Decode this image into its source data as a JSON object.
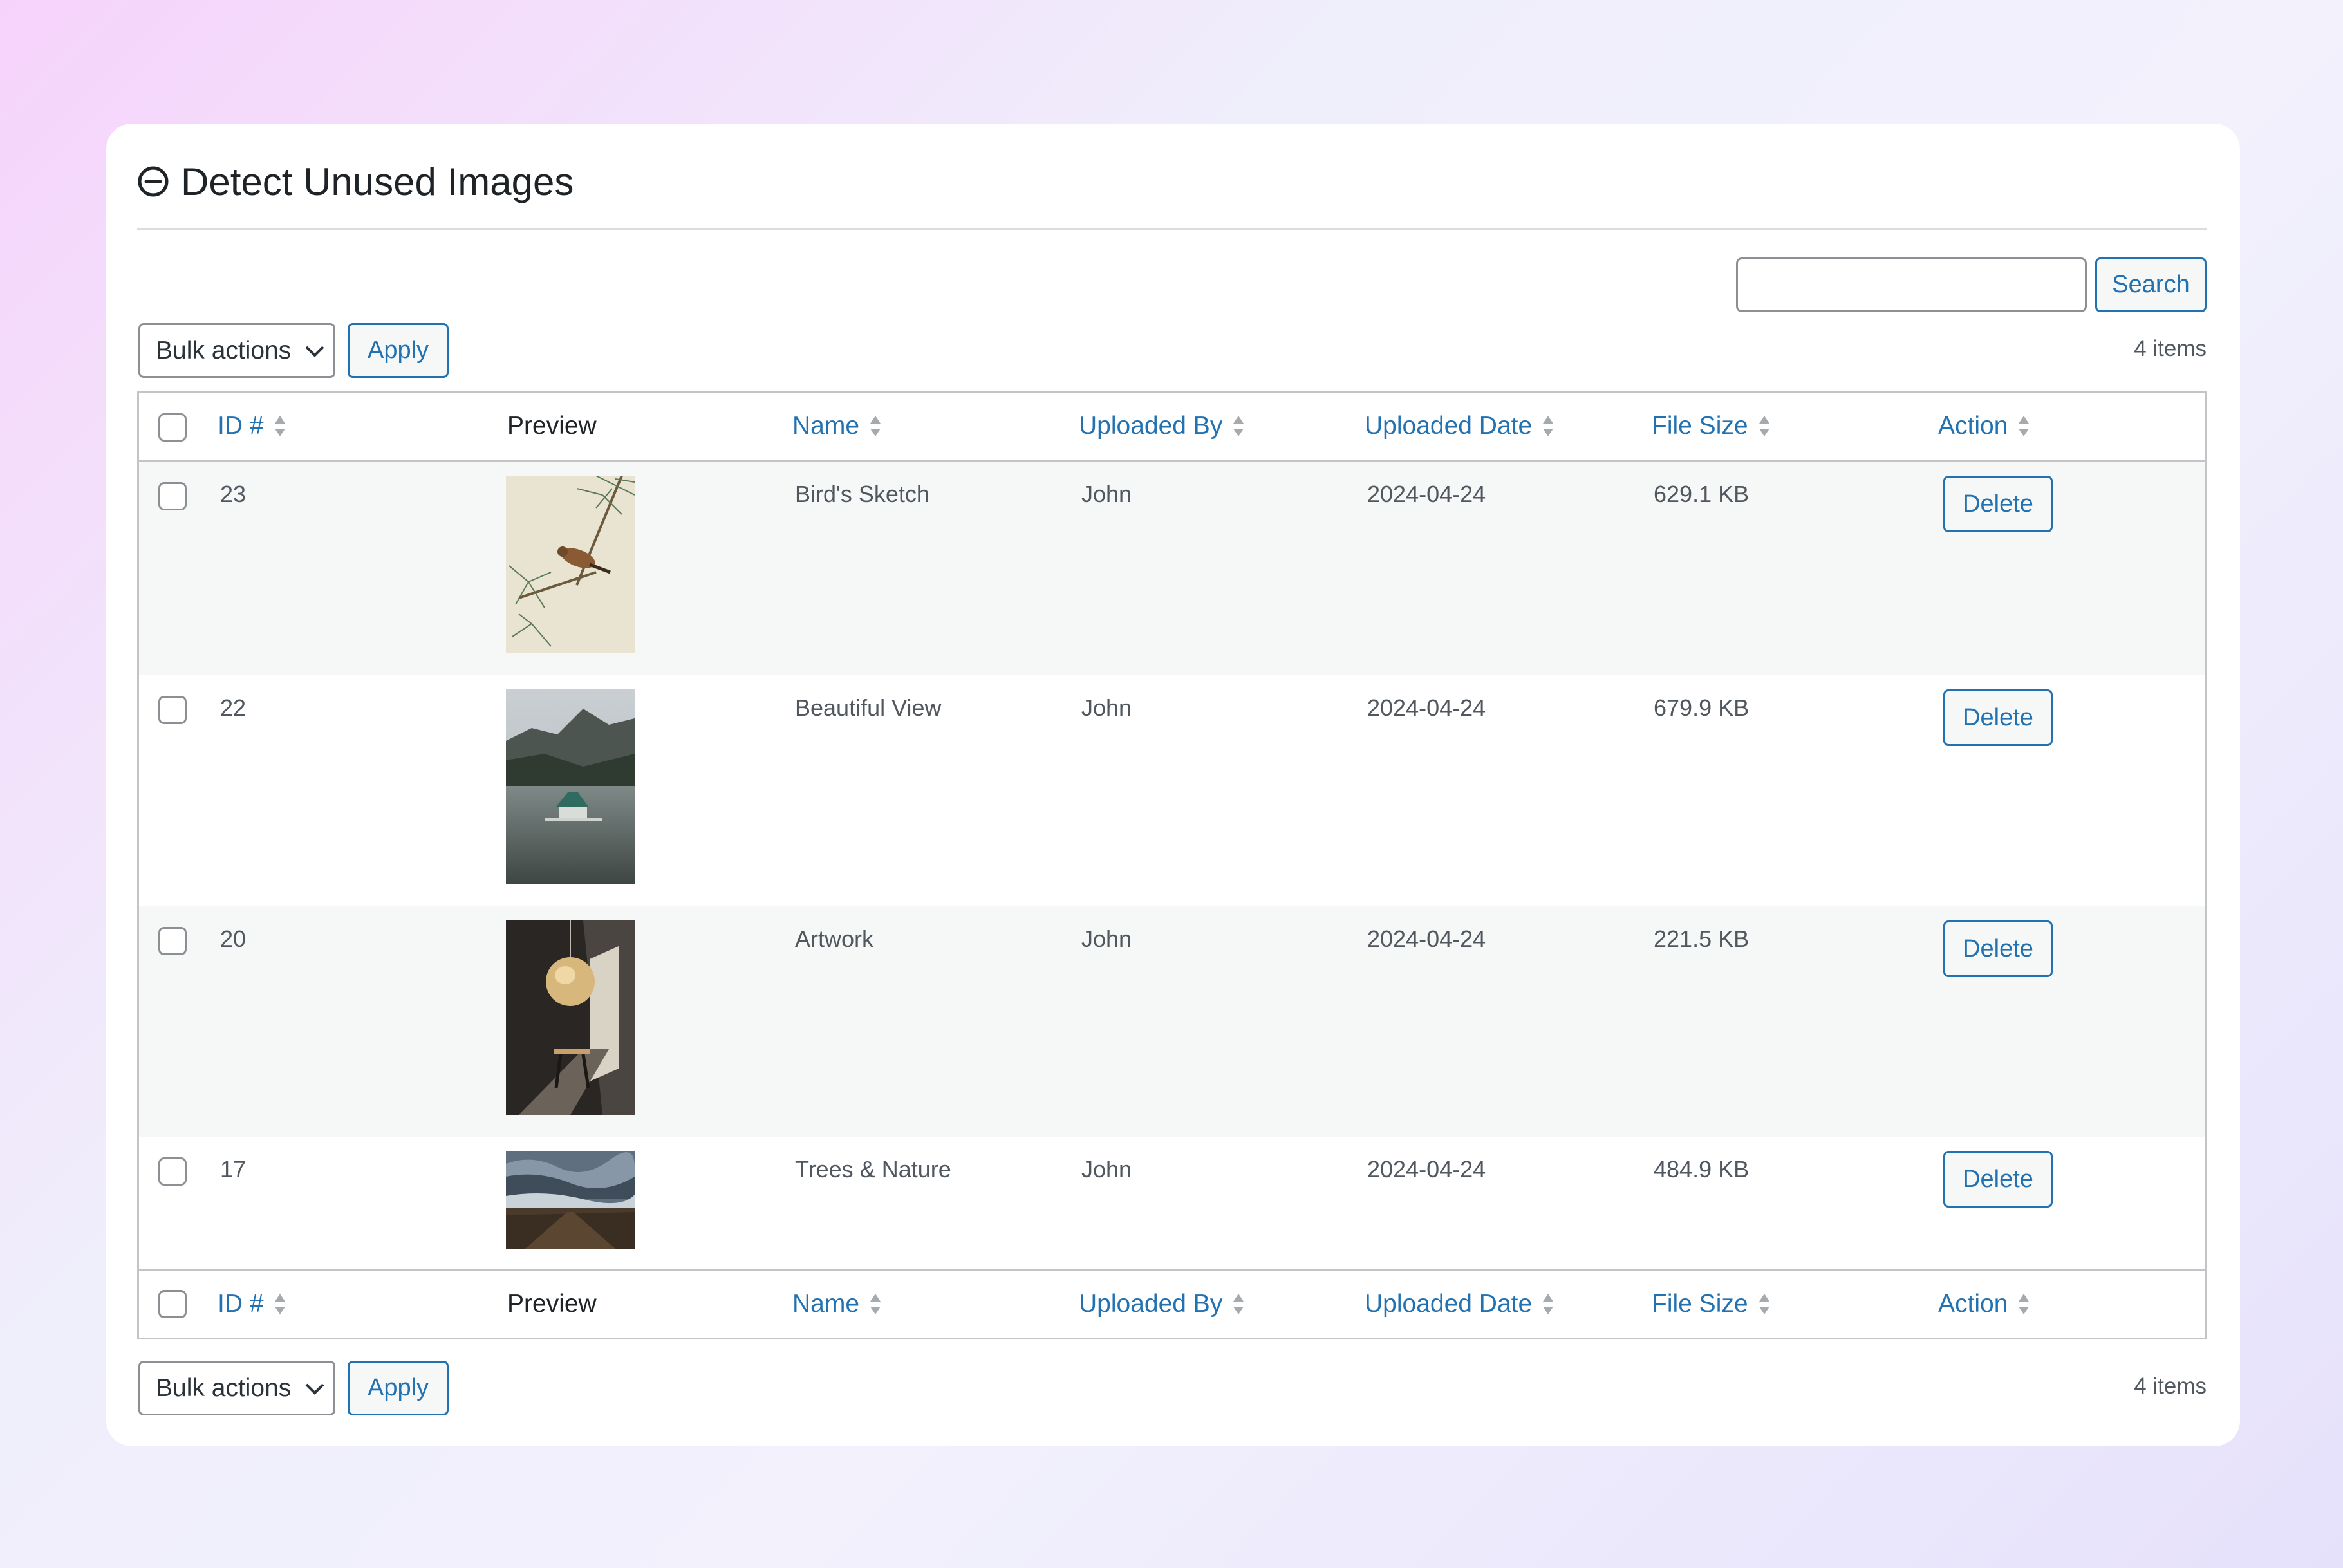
{
  "page": {
    "title": "Detect Unused Images",
    "title_icon": "minus-circle-icon",
    "accent_color": "#2271b1"
  },
  "search": {
    "value": "",
    "placeholder": "",
    "button_label": "Search"
  },
  "toolbar_top": {
    "bulk_label": "Bulk actions",
    "apply_label": "Apply",
    "items_count": "4 items"
  },
  "toolbar_bottom": {
    "bulk_label": "Bulk actions",
    "apply_label": "Apply",
    "items_count": "4 items"
  },
  "columns": {
    "id": "ID #",
    "preview": "Preview",
    "name": "Name",
    "uploaded_by": "Uploaded By",
    "uploaded_date": "Uploaded Date",
    "file_size": "File Size",
    "action": "Action"
  },
  "rows": [
    {
      "id": "23",
      "name": "Bird's Sketch",
      "uploaded_by": "John",
      "uploaded_date": "2024-04-24",
      "file_size": "629.1 KB",
      "action_label": "Delete",
      "preview": "bird-on-pine-branch-image"
    },
    {
      "id": "22",
      "name": "Beautiful View",
      "uploaded_by": "John",
      "uploaded_date": "2024-04-24",
      "file_size": "679.9 KB",
      "action_label": "Delete",
      "preview": "lake-house-mountains-image"
    },
    {
      "id": "20",
      "name": "Artwork",
      "uploaded_by": "John",
      "uploaded_date": "2024-04-24",
      "file_size": "221.5 KB",
      "action_label": "Delete",
      "preview": "lamp-interior-image"
    },
    {
      "id": "17",
      "name": "Trees & Nature",
      "uploaded_by": "John",
      "uploaded_date": "2024-04-24",
      "file_size": "484.9 KB",
      "action_label": "Delete",
      "preview": "stormy-landscape-image"
    }
  ]
}
